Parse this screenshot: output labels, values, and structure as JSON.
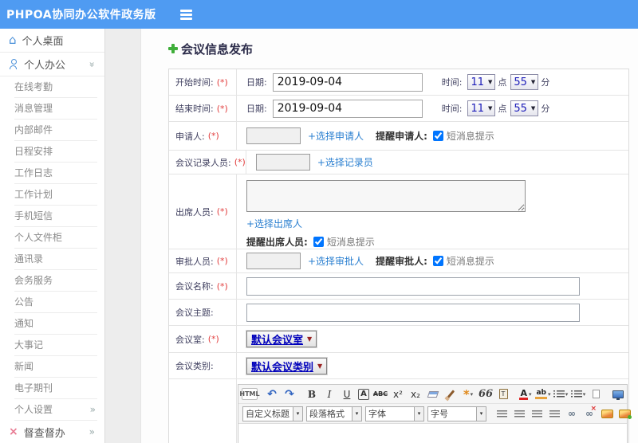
{
  "colors": {
    "header_blue": "#4f9bf2",
    "link_blue": "#2a7fd0",
    "required_red": "#e24040",
    "select_text_blue": "#0000bb",
    "plus_green": "#3fae3a",
    "supervision_pink": "#e87a92",
    "sidebar_icon_blue": "#4a90d9"
  },
  "header": {
    "title": "PHPOA协同办公软件政务版"
  },
  "sidebar": {
    "desktop_label": "个人桌面",
    "office_label": "个人办公",
    "sub_items": [
      "在线考勤",
      "消息管理",
      "内部邮件",
      "日程安排",
      "工作日志",
      "工作计划",
      "手机短信",
      "个人文件柜",
      "通讯录",
      "会务服务",
      "公告",
      "通知",
      "大事记",
      "新闻",
      "电子期刊"
    ],
    "settings_label": "个人设置",
    "supervision_label": "督查督办"
  },
  "main": {
    "page_title": "会议信息发布",
    "form": {
      "start_time": {
        "label": "开始时间:",
        "required": "(*)",
        "date_label": "日期:",
        "date_value": "2019-09-04",
        "time_label": "时间:",
        "hour": "11",
        "hour_unit": "点",
        "minute": "55",
        "minute_unit": "分"
      },
      "end_time": {
        "label": "结束时间:",
        "required": "(*)",
        "date_label": "日期:",
        "date_value": "2019-09-04",
        "time_label": "时间:",
        "hour": "11",
        "hour_unit": "点",
        "minute": "55",
        "minute_unit": "分"
      },
      "applicant": {
        "label": "申请人:",
        "required": "(*)",
        "select_link": "+选择申请人",
        "remind_label": "提醒申请人:",
        "sms_label": "短消息提示",
        "sms_checked": true
      },
      "recorder": {
        "label": "会议记录人员:",
        "required": "(*)",
        "select_link": "+选择记录员"
      },
      "attendees": {
        "label": "出席人员:",
        "required": "(*)",
        "select_link": "+选择出席人",
        "remind_label": "提醒出席人员:",
        "sms_label": "短消息提示",
        "sms_checked": true
      },
      "approver": {
        "label": "审批人员:",
        "required": "(*)",
        "select_link": "+选择审批人",
        "remind_label": "提醒审批人:",
        "sms_label": "短消息提示",
        "sms_checked": true
      },
      "meeting_name": {
        "label": "会议名称:",
        "required": "(*)",
        "value": ""
      },
      "meeting_topic": {
        "label": "会议主题:",
        "value": ""
      },
      "meeting_room": {
        "label": "会议室:",
        "required": "(*)",
        "selected_option": "默认会议室"
      },
      "meeting_category": {
        "label": "会议类别:",
        "selected_option": "默认会议类别"
      }
    },
    "editor": {
      "source_label": "HTML",
      "undo_glyph": "↶",
      "redo_glyph": "↷",
      "bold_glyph": "B",
      "italic_glyph": "I",
      "underline_glyph": "U",
      "font_box_glyph": "A",
      "strike_glyph": "ABC",
      "sup_glyph": "x²",
      "sub_glyph": "x₂",
      "quote_glyph": "66",
      "font_color_glyph": "A",
      "highlight_glyph": "ab",
      "heading_select": "自定义标题",
      "paragraph_select": "段落格式",
      "font_select": "字体",
      "size_select": "字号"
    }
  }
}
